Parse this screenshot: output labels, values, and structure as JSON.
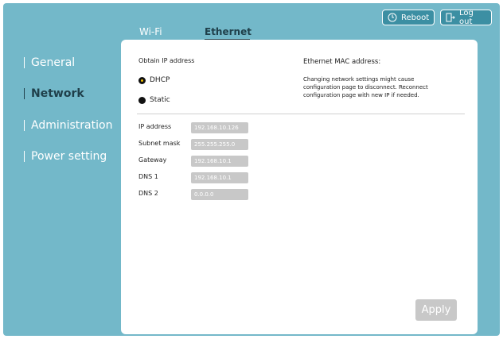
{
  "header": {
    "reboot_label": "Reboot",
    "logout_label": "Log out",
    "tabs": [
      {
        "label": "Wi-Fi",
        "active": false
      },
      {
        "label": "Ethernet",
        "active": true
      }
    ]
  },
  "sidebar": {
    "items": [
      {
        "label": "General",
        "active": false
      },
      {
        "label": "Network",
        "active": true
      },
      {
        "label": "Administration",
        "active": false
      },
      {
        "label": "Power setting",
        "active": false
      }
    ]
  },
  "ip_settings": {
    "obtain_label": "Obtain IP address",
    "options": [
      {
        "label": "DHCP",
        "selected": true
      },
      {
        "label": "Static",
        "selected": false
      }
    ]
  },
  "mac": {
    "title": "Ethernet MAC address:",
    "note": "Changing network settings might cause configuration page to disconnect. Reconnect configuration page with new IP if needed."
  },
  "fields": [
    {
      "label": "IP address",
      "value": "192.168.10.126"
    },
    {
      "label": "Subnet mask",
      "value": "255.255.255.0"
    },
    {
      "label": "Gateway",
      "value": "192.168.10.1"
    },
    {
      "label": "DNS 1",
      "value": "192.168.10.1"
    },
    {
      "label": "DNS 2",
      "value": "0.0.0.0"
    }
  ],
  "apply_label": "Apply",
  "colors": {
    "background": "#73b8c9",
    "button_bg": "#3c8fa3",
    "active_text": "#1f3f4a",
    "disabled_gray": "#c8c8c8",
    "radio_accent": "#f0c000"
  },
  "icons": {
    "reboot": "power-cycle-icon",
    "logout": "logout-door-icon"
  }
}
